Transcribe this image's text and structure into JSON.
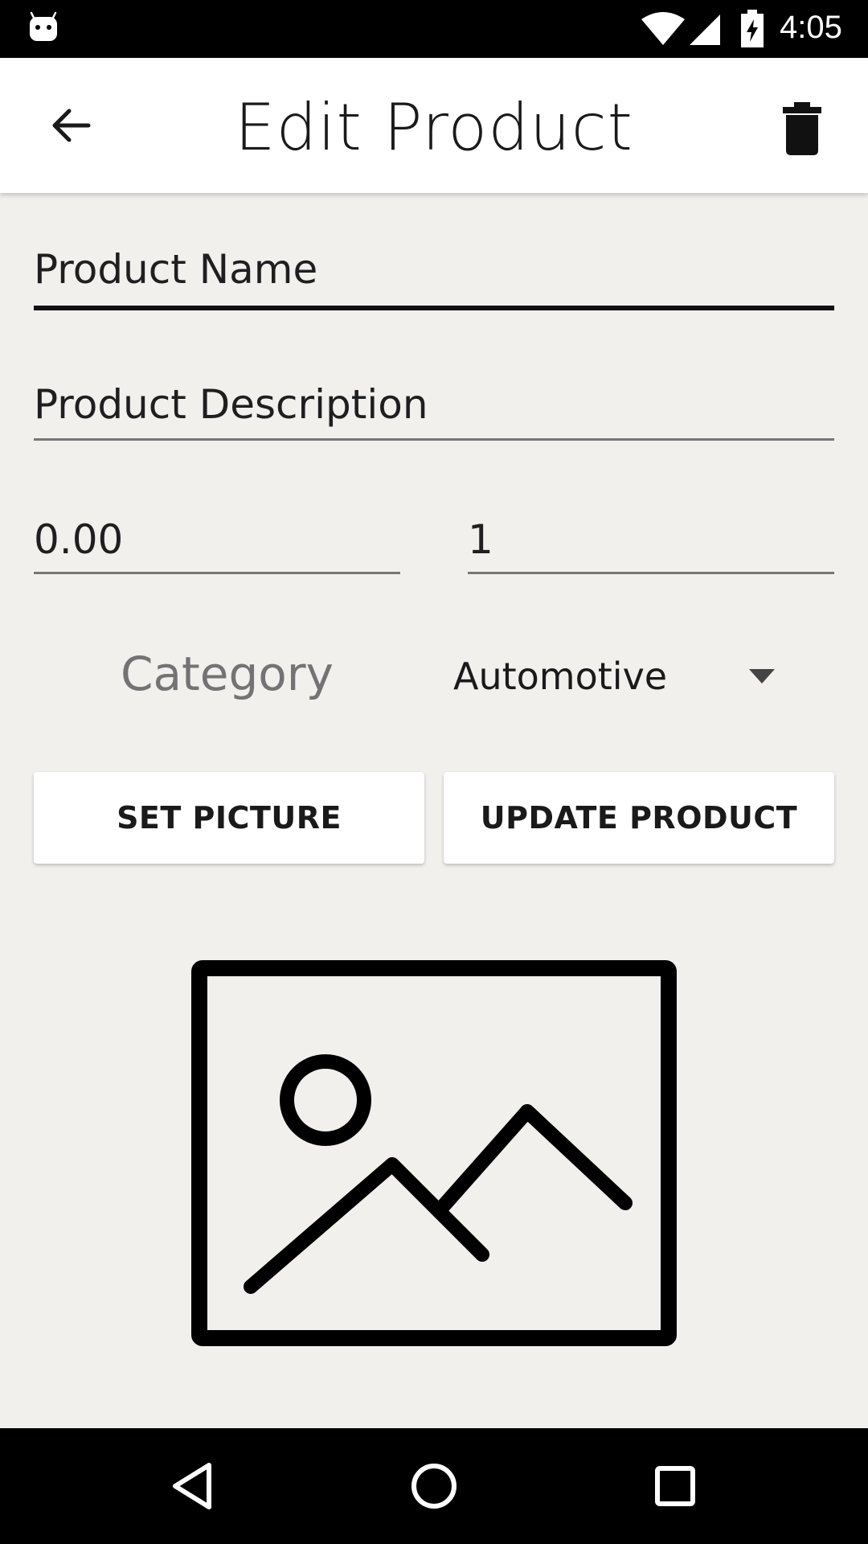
{
  "status_bar": {
    "time": "4:05",
    "icons": [
      "android-icon",
      "wifi-icon",
      "signal-icon",
      "battery-charging-icon"
    ]
  },
  "app_bar": {
    "title": "Edit Product",
    "back_icon": "arrow-back-icon",
    "delete_icon": "trash-icon"
  },
  "form": {
    "product_name": "Product Name",
    "product_description": "Product Description",
    "price": "0.00",
    "quantity": "1",
    "category_label": "Category",
    "category_selected": "Automotive"
  },
  "buttons": {
    "set_picture": "SET PICTURE",
    "update_product": "UPDATE PRODUCT"
  },
  "image": {
    "icon": "image-placeholder-icon"
  },
  "nav_bar": {
    "icons": [
      "nav-back-icon",
      "nav-home-icon",
      "nav-recents-icon"
    ]
  },
  "colors": {
    "background": "#f1f0ed",
    "app_bar": "#ffffff",
    "status_bar": "#000000",
    "nav_bar": "#000000",
    "muted_label": "#737373"
  }
}
